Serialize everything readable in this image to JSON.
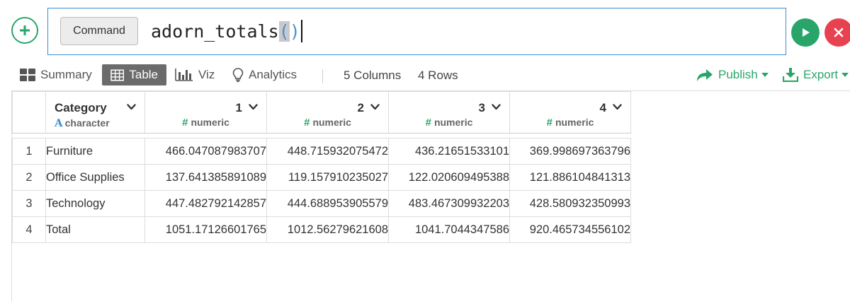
{
  "command": {
    "button_label": "Command",
    "input_text": "adorn_totals",
    "paren_open": "(",
    "paren_close": ")"
  },
  "toolbar": {
    "summary_label": "Summary",
    "table_label": "Table",
    "viz_label": "Viz",
    "analytics_label": "Analytics",
    "columns_count": "5 Columns",
    "rows_count": "4 Rows",
    "publish_label": "Publish",
    "export_label": "Export"
  },
  "table": {
    "columns": [
      {
        "name": "Category",
        "type": "character"
      },
      {
        "name": "1",
        "type": "numeric"
      },
      {
        "name": "2",
        "type": "numeric"
      },
      {
        "name": "3",
        "type": "numeric"
      },
      {
        "name": "4",
        "type": "numeric"
      }
    ],
    "rows": [
      {
        "index": "1",
        "category": "Furniture",
        "values": [
          "466.047087983707",
          "448.715932075472",
          "436.21651533101",
          "369.998697363796"
        ]
      },
      {
        "index": "2",
        "category": "Office Supplies",
        "values": [
          "137.641385891089",
          "119.157910235027",
          "122.020609495388",
          "121.886104841313"
        ]
      },
      {
        "index": "3",
        "category": "Technology",
        "values": [
          "447.482792142857",
          "444.688953905579",
          "483.467309932203",
          "428.580932350993"
        ]
      },
      {
        "index": "4",
        "category": "Total",
        "values": [
          "1051.17126601765",
          "1012.56279621608",
          "1041.7044347586",
          "920.465734556102"
        ]
      }
    ]
  },
  "colors": {
    "accent_green": "#2aa56a",
    "cancel_red": "#e8414f",
    "input_border_blue": "#3b8fd4",
    "active_tab_gray": "#6b6b6b"
  }
}
